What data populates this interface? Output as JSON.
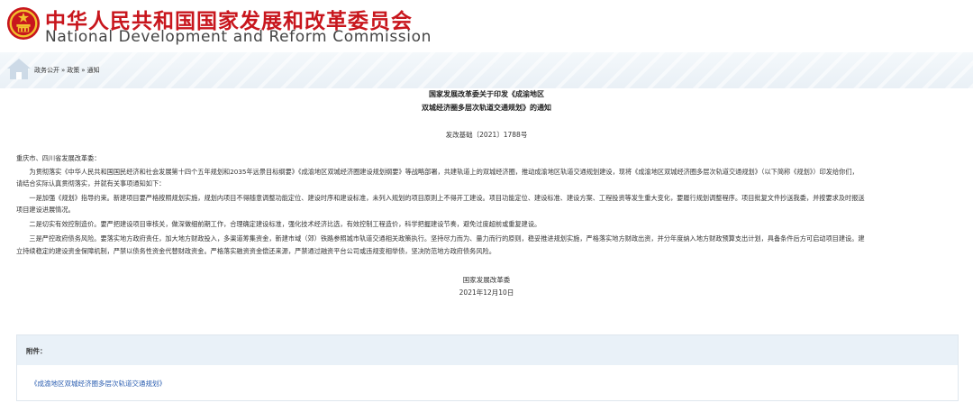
{
  "header": {
    "title_zh": "中华人民共和国国家发展和改革委员会",
    "title_en": "National Development and Reform Commission"
  },
  "breadcrumb": [
    "政务公开",
    "»",
    "政策",
    "»",
    "通知"
  ],
  "document": {
    "title_line1": "国家发展改革委关于印发《成渝地区",
    "title_line2": "双城经济圈多层次轨道交通规划》的通知",
    "doc_number": "发改基础〔2021〕1788号",
    "addressee": "重庆市、四川省发展改革委：",
    "paragraphs": [
      "　　为贯彻落实《中华人民共和国国民经济和社会发展第十四个五年规划和2035年远景目标纲要》《成渝地区双城经济圈建设规划纲要》等战略部署，共建轨道上的双城经济圈，推动成渝地区轨道交通规划建设，现将《成渝地区双城经济圈多层次轨道交通规划》（以下简称《规划》）印发给你们，",
      "请结合实际认真贯彻落实，并就有关事项通知如下：",
      "　　一是加强《规划》指导约束。新建项目要严格按照规划实施，规划内项目不得随意调整功能定位、建设时序和建设标准，未列入规划的项目原则上不得开工建设。项目功能定位、建设标准、建设方案、工程投资等发生重大变化，要履行规划调整程序。项目批复文件抄送我委，并按要求及时报送",
      "项目建设进展情况。",
      "　　二是切实有效控制造价。要严把建设项目审核关，做深做细前期工作，合理确定建设标准，强化技术经济比选，有效控制工程造价，科学把握建设节奏，避免过度超前或重复建设。",
      "　　三是严控政府债务风险。要落实地方政府责任，加大地方财政投入，多渠道筹集资金，新建市域（郊）铁路参照城市轨道交通相关政策执行。坚持尽力而为、量力而行的原则，稳妥推进规划实施，严格落实地方财政出资，并分年度纳入地方财政预算支出计划，具备条件后方可启动项目建设。建",
      "立持续稳定的建设资金保障机制，严禁以债务性资金代替财政资金。严格落实融资资金偿还来源，严禁通过融资平台公司或违规变相举债，坚决防范地方政府债务风险。"
    ],
    "signer": "国家发展改革委",
    "date": "2021年12月10日"
  },
  "attachments": {
    "label": "附件：",
    "items": [
      "《成渝地区双城经济圈多层次轨道交通规划》"
    ]
  },
  "colors": {
    "brand_red": "#c8161d",
    "link_blue": "#2a5db0",
    "attach_header_bg": "#e9f1f8"
  }
}
